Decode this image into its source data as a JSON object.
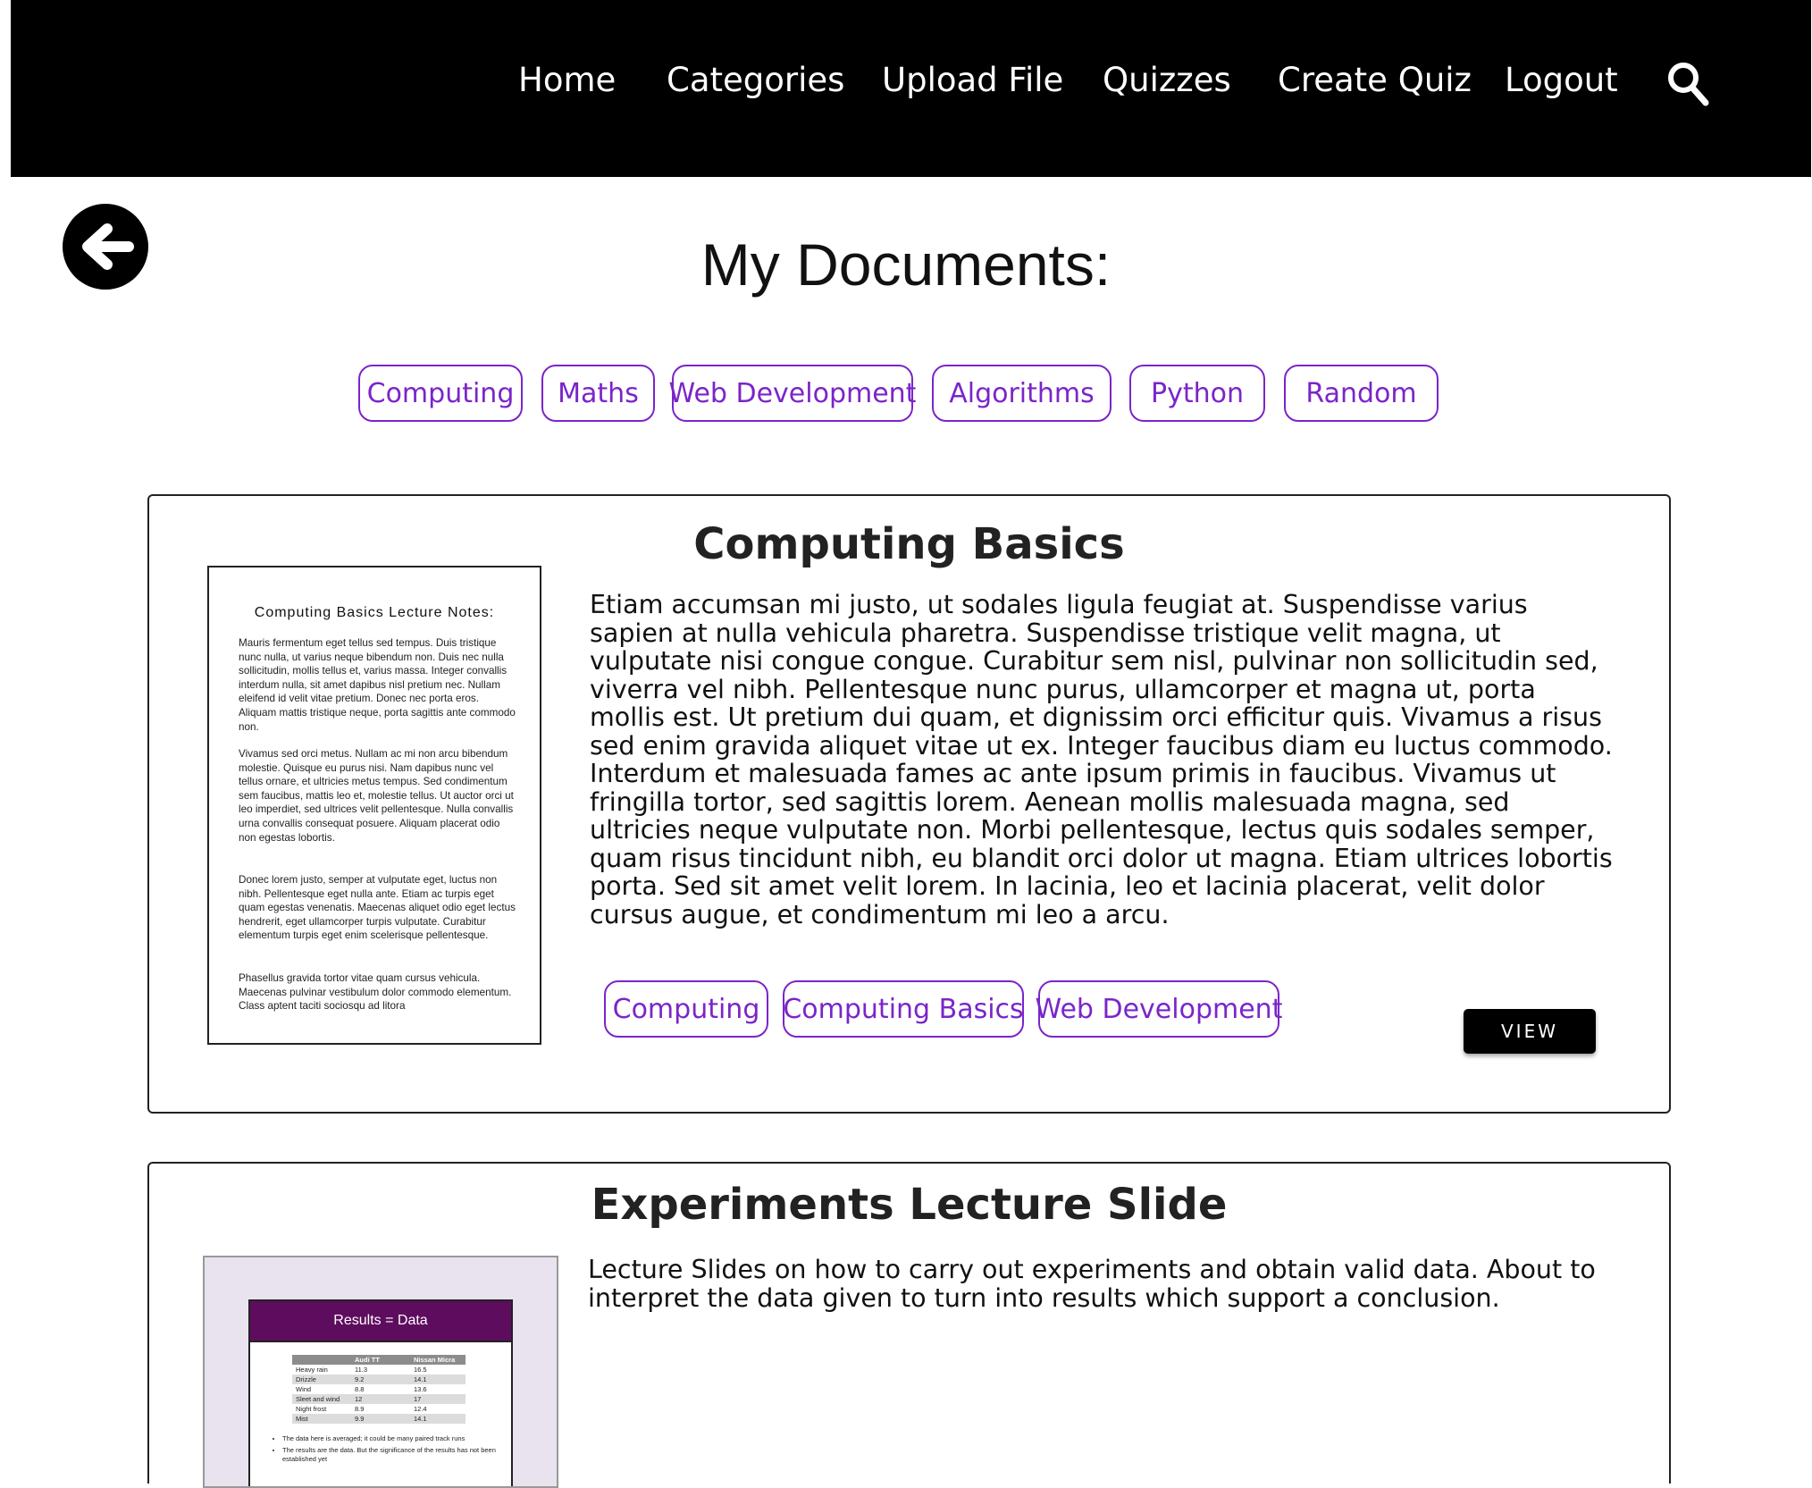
{
  "nav": {
    "links": [
      "Home",
      "Categories",
      "Upload File",
      "Quizzes",
      "Create Quiz",
      "Logout"
    ],
    "search_icon": "search-icon"
  },
  "back_icon": "arrow-left-icon",
  "page_title": "My Documents:",
  "category_filters": [
    "Computing",
    "Maths",
    "Web Development",
    "Algorithms",
    "Python",
    "Random"
  ],
  "colors": {
    "accent": "#7b25c9",
    "nav_bg": "#000000",
    "slide_header": "#5e0d5e"
  },
  "documents": [
    {
      "title": "Computing Basics",
      "description": "Etiam accumsan mi justo, ut sodales ligula feugiat at. Suspendisse varius sapien at nulla vehicula pharetra. Suspendisse tristique velit magna, ut vulputate nisi congue congue. Curabitur sem nisl, pulvinar non sollicitudin sed, viverra vel nibh. Pellentesque nunc purus, ullamcorper et magna ut, porta mollis est. Ut pretium dui quam, et dignissim orci efficitur quis. Vivamus a risus sed enim gravida aliquet vitae ut ex. Integer faucibus diam eu luctus commodo. Interdum et malesuada fames ac ante ipsum primis in faucibus. Vivamus ut fringilla tortor, sed sagittis lorem. Aenean mollis malesuada magna, sed ultricies neque vulputate non. Morbi pellentesque, lectus quis sodales semper, quam risus tincidunt nibh, eu blandit orci dolor ut magna. Etiam ultrices lobortis porta. Sed sit amet velit lorem. In lacinia, leo et lacinia placerat, velit dolor cursus augue, et condimentum mi leo a arcu.",
      "tags": [
        "Computing",
        "Computing Basics",
        "Web Development"
      ],
      "view_label": "VIEW",
      "thumbnail": {
        "title": "Computing Basics Lecture Notes:",
        "paragraphs": [
          "Mauris fermentum eget tellus sed tempus. Duis tristique nunc nulla, ut varius neque bibendum non. Duis nec nulla sollicitudin, mollis tellus et, varius massa. Integer convallis interdum nulla, sit amet dapibus nisl pretium nec. Nullam eleifend id velit vitae pretium. Donec nec porta eros. Aliquam mattis tristique neque, porta sagittis ante commodo non.",
          "Vivamus sed orci metus. Nullam ac mi non arcu bibendum molestie. Quisque eu purus nisi. Nam dapibus nunc vel tellus ornare, et ultricies metus tempus. Sed condimentum sem faucibus, mattis leo et, molestie tellus. Ut auctor orci ut leo imperdiet, sed ultrices velit pellentesque. Nulla convallis urna convallis consequat posuere. Aliquam placerat odio non egestas lobortis.",
          "Donec lorem justo, semper at vulputate eget, luctus non nibh. Pellentesque eget nulla ante. Etiam ac turpis eget quam egestas venenatis. Maecenas aliquet odio eget lectus hendrerit, eget ullamcorper turpis vulputate. Curabitur elementum turpis eget enim scelerisque pellentesque.",
          "Phasellus gravida tortor vitae quam cursus vehicula. Maecenas pulvinar vestibulum dolor commodo elementum. Class aptent taciti sociosqu ad litora"
        ]
      }
    },
    {
      "title": "Experiments Lecture Slide",
      "description": "Lecture Slides on how to carry out experiments and obtain valid data. About to interpret the data given to turn into results which support a conclusion.",
      "thumbnail": {
        "slide_title": "Results = Data",
        "table_headers": [
          "",
          "Audi TT",
          "Nissan Micra"
        ],
        "table_rows": [
          [
            "Heavy rain",
            "11.3",
            "16.5"
          ],
          [
            "Drizzle",
            "9.2",
            "14.1"
          ],
          [
            "Wind",
            "8.8",
            "13.6"
          ],
          [
            "Sleet and wind",
            "12",
            "17"
          ],
          [
            "Night frost",
            "8.9",
            "12.4"
          ],
          [
            "Mist",
            "9.9",
            "14.1"
          ]
        ],
        "bullets": [
          "The data here is averaged; it could be many paired track runs",
          "The results are the data. But the significance of the results has not been established yet"
        ]
      }
    }
  ]
}
